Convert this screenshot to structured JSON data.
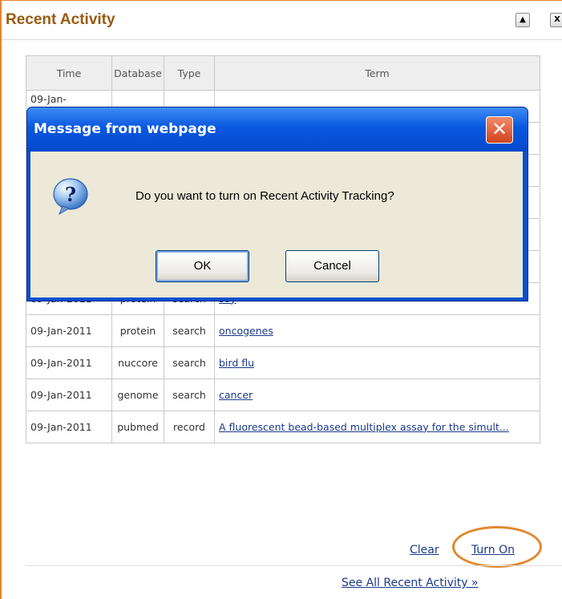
{
  "panel": {
    "title": "Recent Activity",
    "collapse_label": "▲",
    "close_label": "X"
  },
  "table": {
    "headers": [
      "Time",
      "Database",
      "Type",
      "Term"
    ],
    "rows": [
      {
        "time": "09-Jan-2011",
        "database": "protein",
        "type": "search",
        "term": "soy"
      },
      {
        "time": "09-Jan-2011",
        "database": "protein",
        "type": "search",
        "term": "oncogenes"
      },
      {
        "time": "09-Jan-2011",
        "database": "nuccore",
        "type": "search",
        "term": "bird flu"
      },
      {
        "time": "09-Jan-2011",
        "database": "genome",
        "type": "search",
        "term": "cancer"
      },
      {
        "time": "09-Jan-2011",
        "database": "pubmed",
        "type": "record",
        "term": "A fluorescent bead-based multiplex assay for the simult..."
      }
    ],
    "partial_first_time": "09-Jan-"
  },
  "footer": {
    "clear_label": "Clear",
    "turn_on_label": "Turn On",
    "see_all_label": "See All Recent Activity »"
  },
  "dialog": {
    "title": "Message from webpage",
    "close_label": "✕",
    "message": "Do you want to turn on Recent Activity Tracking?",
    "ok_label": "OK",
    "cancel_label": "Cancel"
  },
  "colors": {
    "accent": "#e8822e",
    "title_text": "#9a5a0f",
    "link": "#1a3a8a",
    "dialog_blue": "#0b4fcf"
  }
}
